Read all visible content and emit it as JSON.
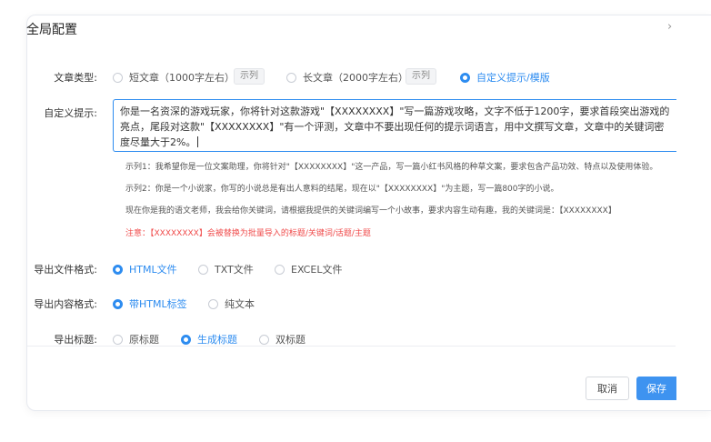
{
  "dialog": {
    "title": "全局配置",
    "close_icon": "chevron-right-icon"
  },
  "article_type": {
    "label": "文章类型:",
    "options": [
      {
        "label": "短文章（1000字左右）",
        "selected": false,
        "tag": "示列"
      },
      {
        "label": "长文章（2000字左右）",
        "selected": false,
        "tag": "示列"
      },
      {
        "label": "自定义提示/模版",
        "selected": true
      }
    ]
  },
  "custom_prompt": {
    "label": "自定义提示:",
    "value": "你是一名资深的游戏玩家，你将针对这款游戏\"【XXXXXXXX】\"写一篇游戏攻略，文字不低于1200字，要求首段突出游戏的亮点，尾段对这款\"【XXXXXXXX】\"有一个评测，文章中不要出现任何的提示词语言，用中文撰写文章，文章中的关键词密度尽量大于2%。",
    "examples": [
      "示列1：我希望你是一位文案助理，你将针对\"【XXXXXXXX】\"这一产品，写一篇小红书风格的种草文案，要求包含产品功效、特点以及使用体验。",
      "示列2：你是一个小说家，你写的小说总是有出人意料的结尾，现在以\"【XXXXXXXX】\"为主题，写一篇800字的小说。",
      "现在你是我的语文老师，我会给你关键词，请根据我提供的关键词编写一个小故事，要求内容生动有趣，我的关键词是：【XXXXXXXX】"
    ],
    "note": "注意：【XXXXXXXX】会被替换为批量导入的标题/关键词/话题/主题"
  },
  "export_format": {
    "label": "导出文件格式:",
    "options": [
      {
        "label": "HTML文件",
        "selected": true
      },
      {
        "label": "TXT文件",
        "selected": false
      },
      {
        "label": "EXCEL文件",
        "selected": false
      }
    ]
  },
  "export_content": {
    "label": "导出内容格式:",
    "options": [
      {
        "label": "带HTML标签",
        "selected": true
      },
      {
        "label": "纯文本",
        "selected": false
      }
    ]
  },
  "export_title": {
    "label": "导出标题:",
    "options": [
      {
        "label": "原标题",
        "selected": false
      },
      {
        "label": "生成标题",
        "selected": true
      },
      {
        "label": "双标题",
        "selected": false
      }
    ]
  },
  "footer": {
    "cancel_label": "取消",
    "save_label": "保存"
  },
  "colors": {
    "accent": "#2d8cf0",
    "warning": "#f04b4b"
  }
}
